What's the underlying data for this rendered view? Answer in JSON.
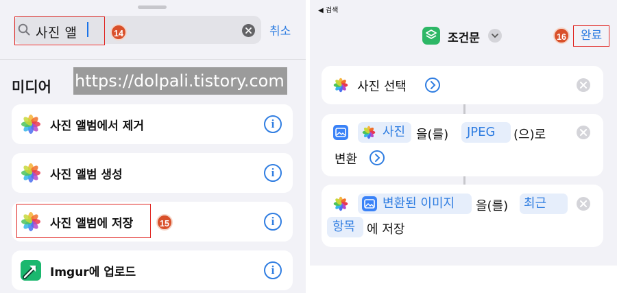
{
  "left": {
    "search": {
      "query": "사진 앨",
      "cancel_label": "취소"
    },
    "badge_14": "14",
    "section_title": "미디어",
    "watermark": "https://dolpali.tistory.com",
    "actions": [
      {
        "label": "사진 앨범에서 제거",
        "icon": "photos-icon"
      },
      {
        "label": "사진 앨범 생성",
        "icon": "photos-icon"
      },
      {
        "label": "사진 앨범에 저장",
        "icon": "photos-icon"
      },
      {
        "label": "Imgur에 업로드",
        "icon": "imgur-icon"
      }
    ],
    "badge_15": "15"
  },
  "right": {
    "back_label": "◀ 검색",
    "title": "조건문",
    "done_label": "완료",
    "badge_16": "16",
    "steps": {
      "select_photo": {
        "label": "사진 선택"
      },
      "convert": {
        "input_token": "사진",
        "particle_1": "을(를)",
        "format_token": "JPEG",
        "particle_2": "(으)로",
        "verb": "변환"
      },
      "save": {
        "input_token": "변환된 이미지",
        "particle_1": "을(를)",
        "album_token_line1": "최근",
        "album_token_line2": "항목",
        "suffix": "에 저장"
      }
    }
  },
  "colors": {
    "accent": "#2f7de1",
    "annotation": "#e0231f",
    "badge": "#d9502a",
    "shortcut_app": "#2db766"
  }
}
